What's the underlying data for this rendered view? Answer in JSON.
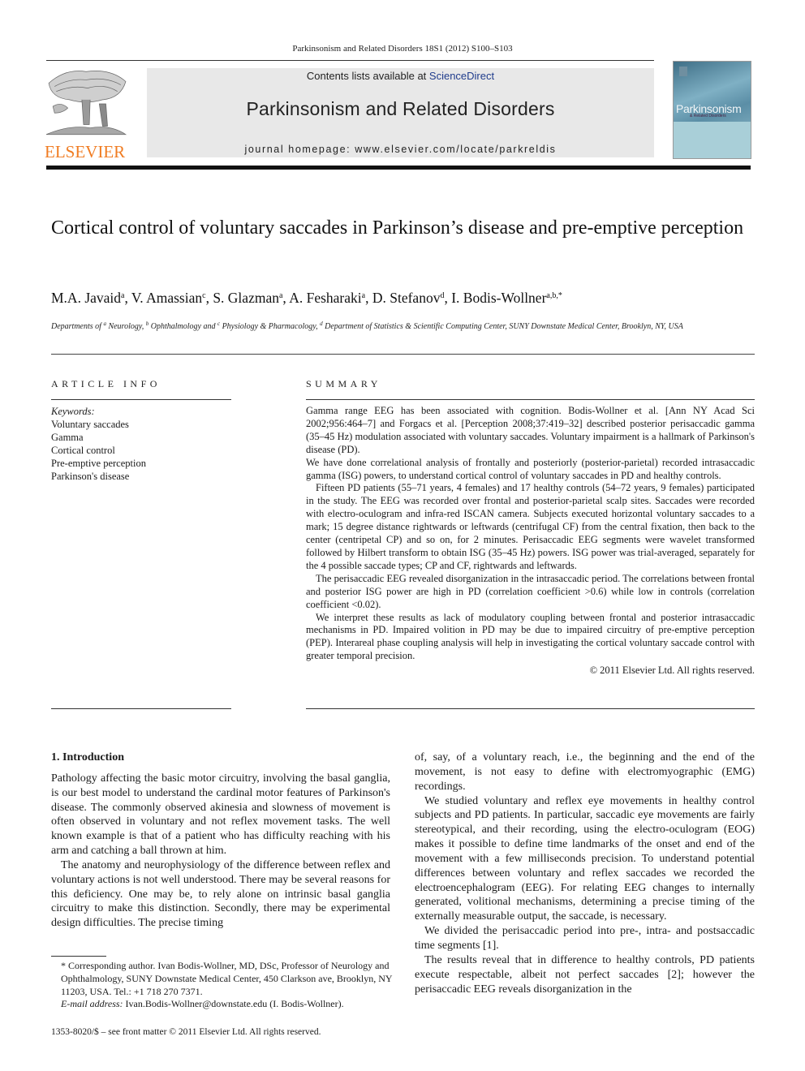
{
  "running_header": "Parkinsonism and Related Disorders 18S1 (2012) S100–S103",
  "masthead": {
    "publisher_logo_text": "ELSEVIER",
    "contents_prefix": "Contents lists available at ",
    "contents_link": "ScienceDirect",
    "journal_title": "Parkinsonism and Related Disorders",
    "homepage": "journal homepage: www.elsevier.com/locate/parkreldis",
    "cover_title": "Parkinsonism",
    "cover_subtitle": "& Related Disorders",
    "colors": {
      "elsevier_orange": "#f07c22",
      "sciencedirect_blue": "#1f3c8c",
      "banner_gray": "#e8e8e8"
    }
  },
  "article": {
    "title": "Cortical control of voluntary saccades in Parkinson’s disease and pre-emptive perception",
    "authors": [
      {
        "name": "M.A. Javaid",
        "sup": "a",
        "sep": ", "
      },
      {
        "name": "V. Amassian",
        "sup": "c",
        "sep": ", "
      },
      {
        "name": "S. Glazman",
        "sup": "a",
        "sep": ", "
      },
      {
        "name": "A. Fesharaki",
        "sup": "a",
        "sep": ", "
      },
      {
        "name": "D. Stefanov",
        "sup": "d",
        "sep": ", "
      },
      {
        "name": "I. Bodis-Wollner",
        "sup": "a,b,",
        "sep": ""
      }
    ],
    "corresponding_mark": "*",
    "affiliation": {
      "prefix": "Departments of ",
      "parts": [
        {
          "sup": "a",
          "text": " Neurology, "
        },
        {
          "sup": "b",
          "text": " Ophthalmology and "
        },
        {
          "sup": "c",
          "text": " Physiology & Pharmacology, "
        },
        {
          "sup": "d",
          "text": " Department of Statistics & Scientific Computing Center, SUNY Downstate Medical Center, Brooklyn, NY, USA"
        }
      ]
    }
  },
  "article_info": {
    "heading": "ARTICLE INFO",
    "keywords_label": "Keywords:",
    "keywords": [
      "Voluntary saccades",
      "Gamma",
      "Cortical control",
      "Pre-emptive perception",
      "Parkinson's disease"
    ]
  },
  "summary": {
    "heading": "SUMMARY",
    "paragraphs": [
      "Gamma range EEG has been associated with cognition. Bodis-Wollner et al. [Ann NY Acad Sci 2002;956:464–7] and Forgacs et al. [Perception 2008;37:419–32] described posterior perisaccadic gamma (35–45 Hz) modulation associated with voluntary saccades. Voluntary impairment is a hallmark of Parkinson's disease (PD).",
      "We have done correlational analysis of frontally and posteriorly (posterior-parietal) recorded intrasaccadic gamma (ISG) powers, to understand cortical control of voluntary saccades in PD and healthy controls.",
      "Fifteen PD patients (55–71 years, 4 females) and 17 healthy controls (54–72 years, 9 females) participated in the study. The EEG was recorded over frontal and posterior-parietal scalp sites. Saccades were recorded with electro-oculogram and infra-red ISCAN camera. Subjects executed horizontal voluntary saccades to a mark; 15 degree distance rightwards or leftwards (centrifugal CF) from the central fixation, then back to the center (centripetal CP) and so on, for 2 minutes. Perisaccadic EEG segments were wavelet transformed followed by Hilbert transform to obtain ISG (35–45 Hz) powers. ISG power was trial-averaged, separately for the 4 possible saccade types; CP and CF, rightwards and leftwards.",
      "The perisaccadic EEG revealed disorganization in the intrasaccadic period. The correlations between frontal and posterior ISG power are high in PD (correlation coefficient >0.6) while low in controls (correlation coefficient <0.02).",
      "We interpret these results as lack of modulatory coupling between frontal and posterior intrasaccadic mechanisms in PD. Impaired volition in PD may be due to impaired circuitry of pre-emptive perception (PEP). Interareal phase coupling analysis will help in investigating the cortical voluntary saccade control with greater temporal precision."
    ],
    "copyright": "© 2011 Elsevier Ltd. All rights reserved."
  },
  "body": {
    "section_title": "1. Introduction",
    "left_paragraphs": [
      "Pathology affecting the basic motor circuitry, involving the basal ganglia, is our best model to understand the cardinal motor features of Parkinson's disease. The commonly observed akinesia and slowness of movement is often observed in voluntary and not reflex movement tasks. The well known example is that of a patient who has difficulty reaching with his arm and catching a ball thrown at him.",
      "The anatomy and neurophysiology of the difference between reflex and voluntary actions is not well understood. There may be several reasons for this deficiency. One may be, to rely alone on intrinsic basal ganglia circuitry to make this distinction. Secondly, there may be experimental design difficulties. The precise timing"
    ],
    "right_paragraphs": [
      "of, say, of a voluntary reach, i.e., the beginning and the end of the movement, is not easy to define with electromyographic (EMG) recordings.",
      "We studied voluntary and reflex eye movements in healthy control subjects and PD patients. In particular, saccadic eye movements are fairly stereotypical, and their recording, using the electro-oculogram (EOG) makes it possible to define time landmarks of the onset and end of the movement with a few milliseconds precision. To understand potential differences between voluntary and reflex saccades we recorded the electroencephalogram (EEG). For relating EEG changes to internally generated, volitional mechanisms, determining a precise timing of the externally measurable output, the saccade, is necessary.",
      "We divided the perisaccadic period into pre-, intra- and postsaccadic time segments [1].",
      "The results reveal that in difference to healthy controls, PD patients execute respectable, albeit not perfect saccades [2]; however the perisaccadic EEG reveals disorganization in the"
    ]
  },
  "footnote": {
    "line1": "* Corresponding author. Ivan Bodis-Wollner, MD, DSc, Professor of Neurology and Ophthalmology, SUNY Downstate Medical Center, 450 Clarkson ave, Brooklyn, NY 11203, USA. Tel.: +1 718 270 7371.",
    "email_label": "E-mail address:",
    "email_value": " Ivan.Bodis-Wollner@downstate.edu (I. Bodis-Wollner)."
  },
  "front_matter": "1353-8020/$ – see front matter © 2011 Elsevier Ltd. All rights reserved."
}
